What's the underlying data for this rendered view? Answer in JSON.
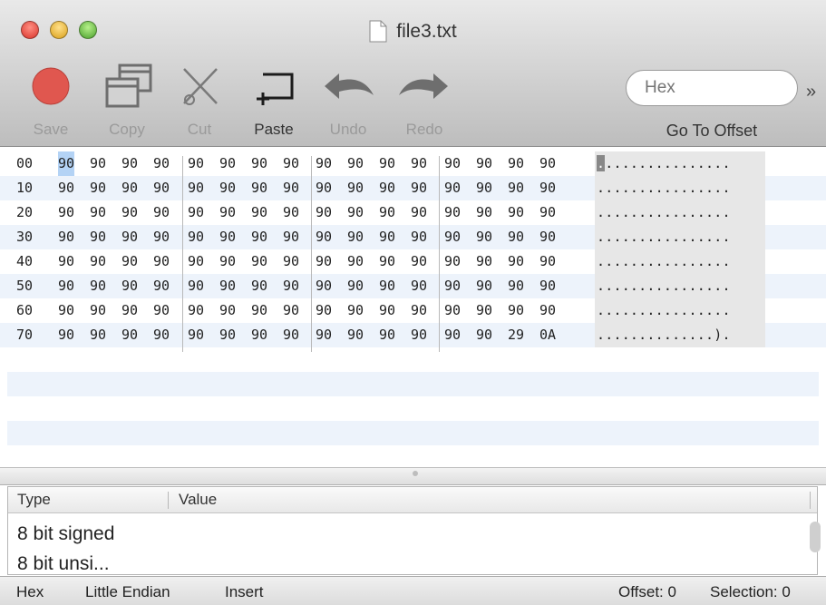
{
  "window": {
    "title": "file3.txt"
  },
  "toolbar": {
    "items": [
      {
        "label": "Save",
        "enabled": false
      },
      {
        "label": "Copy",
        "enabled": false
      },
      {
        "label": "Cut",
        "enabled": false
      },
      {
        "label": "Paste",
        "enabled": true
      },
      {
        "label": "Undo",
        "enabled": false
      },
      {
        "label": "Redo",
        "enabled": false
      }
    ],
    "offset_field": {
      "placeholder": "Hex",
      "label": "Go To Offset"
    },
    "overflow": "»"
  },
  "colors": {
    "selection": "#b4d3f5",
    "alternate_row": "#edf3fb",
    "ascii_bg": "#e7e7e7",
    "save_circle": "#e0574f"
  },
  "hex": {
    "rows": [
      {
        "offset": "00",
        "bytes": [
          "90",
          "90",
          "90",
          "90",
          "90",
          "90",
          "90",
          "90",
          "90",
          "90",
          "90",
          "90",
          "90",
          "90",
          "90",
          "90"
        ],
        "ascii": "................"
      },
      {
        "offset": "10",
        "bytes": [
          "90",
          "90",
          "90",
          "90",
          "90",
          "90",
          "90",
          "90",
          "90",
          "90",
          "90",
          "90",
          "90",
          "90",
          "90",
          "90"
        ],
        "ascii": "................"
      },
      {
        "offset": "20",
        "bytes": [
          "90",
          "90",
          "90",
          "90",
          "90",
          "90",
          "90",
          "90",
          "90",
          "90",
          "90",
          "90",
          "90",
          "90",
          "90",
          "90"
        ],
        "ascii": "................"
      },
      {
        "offset": "30",
        "bytes": [
          "90",
          "90",
          "90",
          "90",
          "90",
          "90",
          "90",
          "90",
          "90",
          "90",
          "90",
          "90",
          "90",
          "90",
          "90",
          "90"
        ],
        "ascii": "................"
      },
      {
        "offset": "40",
        "bytes": [
          "90",
          "90",
          "90",
          "90",
          "90",
          "90",
          "90",
          "90",
          "90",
          "90",
          "90",
          "90",
          "90",
          "90",
          "90",
          "90"
        ],
        "ascii": "................"
      },
      {
        "offset": "50",
        "bytes": [
          "90",
          "90",
          "90",
          "90",
          "90",
          "90",
          "90",
          "90",
          "90",
          "90",
          "90",
          "90",
          "90",
          "90",
          "90",
          "90"
        ],
        "ascii": "................"
      },
      {
        "offset": "60",
        "bytes": [
          "90",
          "90",
          "90",
          "90",
          "90",
          "90",
          "90",
          "90",
          "90",
          "90",
          "90",
          "90",
          "90",
          "90",
          "90",
          "90"
        ],
        "ascii": "................"
      },
      {
        "offset": "70",
        "bytes": [
          "90",
          "90",
          "90",
          "90",
          "90",
          "90",
          "90",
          "90",
          "90",
          "90",
          "90",
          "90",
          "90",
          "90",
          "29",
          "0A"
        ],
        "ascii": "..............)."
      }
    ]
  },
  "inspector": {
    "columns": [
      "Type",
      "Value"
    ],
    "rows": [
      "8 bit signed",
      "8 bit unsi..."
    ]
  },
  "statusbar": {
    "mode": "Hex",
    "endian": "Little Endian",
    "insert": "Insert",
    "offset": "Offset: 0",
    "selection": "Selection: 0"
  }
}
